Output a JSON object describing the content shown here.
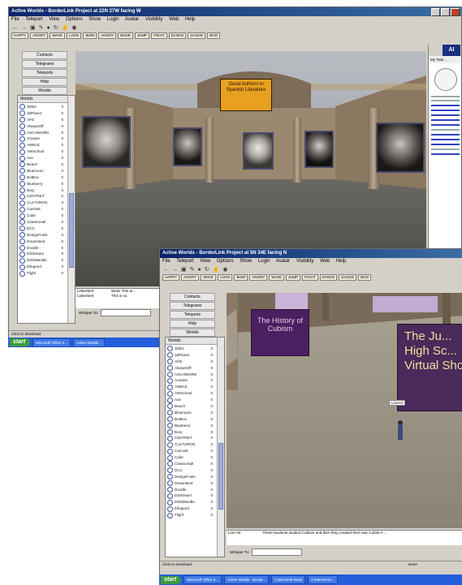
{
  "window_back": {
    "title": "Active Worlds - BorderLink Project at 22N 27W facing W",
    "menu": [
      "File",
      "Teleport",
      "View",
      "Options",
      "Show",
      "Login",
      "Avatar",
      "Visibility",
      "Web",
      "Help"
    ],
    "gestures": [
      "HAPPY",
      "ANGRY",
      "WAVE",
      "LOOK",
      "BOW",
      "ANGRY",
      "WAVE",
      "JUMP",
      "FIGHT",
      "DANCE",
      "DANCE",
      "BOO"
    ],
    "nav_buttons": [
      "Contacts",
      "Telegrams",
      "Teleports",
      "Help",
      "Worlds"
    ],
    "worlds_header": "Worlds",
    "sign_text": "Great Authors in Spanish Literature",
    "chat": [
      {
        "name": "Linkerbert",
        "text": "Wow! This ar..."
      },
      {
        "name": "Linkerbert",
        "text": "This is so"
      }
    ],
    "chat_input_label": "Whisper To:",
    "status": "Click to download",
    "browser_label": "My Task..."
  },
  "window_front": {
    "title": "Active Worlds - BorderLink Project at 5N 34E facing N",
    "menu": [
      "File",
      "Teleport",
      "View",
      "Options",
      "Show",
      "Login",
      "Avatar",
      "Visibility",
      "Web",
      "Help"
    ],
    "gestures": [
      "HAPPY",
      "ANGRY",
      "WAVE",
      "LOOK",
      "BOW",
      "ANGRY",
      "WAVE",
      "JUMP",
      "FIGHT",
      "DANCE",
      "DANCE",
      "BOO"
    ],
    "nav_buttons": [
      "Contacts",
      "Telegrams",
      "Teleports",
      "Help",
      "Worlds"
    ],
    "worlds_header": "Worlds",
    "sign_left": "The History of Cubism",
    "sign_right": "The Ju... High Sc... Virtual Show",
    "avatar_tag": "LineArt",
    "chat": [
      {
        "name": "Line Art",
        "text": "These students studied Cubism and then they created their own Cubist A..."
      }
    ],
    "chat_input_label": "Whisper To:",
    "status": "Click to download",
    "status_right": "Done"
  },
  "worlds": [
    {
      "name": "3Dbtc",
      "count": "0"
    },
    {
      "name": "3dPlanet",
      "count": "0"
    },
    {
      "name": "AFD",
      "count": "0"
    },
    {
      "name": "AlwaysOff",
      "count": "0"
    },
    {
      "name": "ASCHWORD",
      "count": "0"
    },
    {
      "name": "Aruatan",
      "count": "0"
    },
    {
      "name": "AWEnd",
      "count": "0"
    },
    {
      "name": "AWSchool",
      "count": "0"
    },
    {
      "name": "Axe",
      "count": "0"
    },
    {
      "name": "Beach",
      "count": "0"
    },
    {
      "name": "Bluemoon",
      "count": "0"
    },
    {
      "name": "BotBox",
      "count": "0"
    },
    {
      "name": "Blueberry",
      "count": "0"
    },
    {
      "name": "Bury",
      "count": "0"
    },
    {
      "name": "CENTRET",
      "count": "0"
    },
    {
      "name": "CULTURON",
      "count": "0"
    },
    {
      "name": "Cannals",
      "count": "0"
    },
    {
      "name": "Cube",
      "count": "0"
    },
    {
      "name": "Classicmall",
      "count": "0"
    },
    {
      "name": "DCC",
      "count": "0"
    },
    {
      "name": "DesignFuels",
      "count": "0"
    },
    {
      "name": "Dreamland",
      "count": "0"
    },
    {
      "name": "Doodle",
      "count": "0"
    },
    {
      "name": "DSStream",
      "count": "0"
    },
    {
      "name": "DSDMandle",
      "count": "0"
    },
    {
      "name": "Ellegend",
      "count": "0"
    },
    {
      "name": "Flight",
      "count": "0"
    }
  ],
  "taskbar": {
    "start_label": "start",
    "tasks_back": [
      "Microsoft Office 2...",
      "Active Worlds..."
    ],
    "tasks_front": [
      "Microsoft Office 2...",
      "Active Worlds - Borde...",
      "3 Microsoft Word",
      "3 Internet Ex..."
    ]
  },
  "colors": {
    "titlebar": "#0a246a",
    "chrome": "#d4d0c8",
    "sign_orange": "#e8a020",
    "sign_purple": "#4a2060",
    "taskbar": "#245edb"
  }
}
